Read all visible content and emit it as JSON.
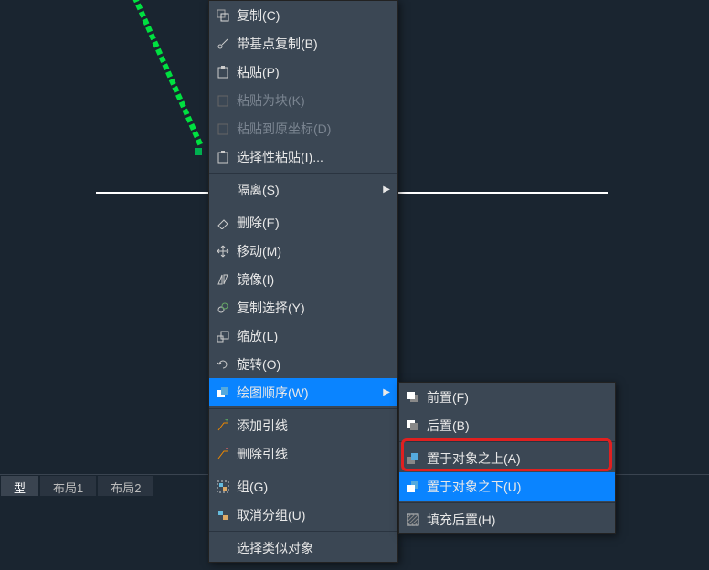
{
  "canvas": {
    "tabs": [
      "型",
      "布局1",
      "布局2"
    ]
  },
  "menu": {
    "items": [
      {
        "icon": "copy-icon",
        "label": "复制(C)"
      },
      {
        "icon": "basepoint-copy-icon",
        "label": "带基点复制(B)"
      },
      {
        "icon": "paste-icon",
        "label": "粘贴(P)"
      },
      {
        "icon": "paste-block-icon",
        "label": "粘贴为块(K)",
        "disabled": true
      },
      {
        "icon": "paste-orig-icon",
        "label": "粘贴到原坐标(D)",
        "disabled": true
      },
      {
        "icon": "paste-special-icon",
        "label": "选择性粘贴(I)..."
      },
      {
        "separator": true
      },
      {
        "icon": "",
        "label": "隔离(S)",
        "submenu": true
      },
      {
        "separator": true
      },
      {
        "icon": "erase-icon",
        "label": "删除(E)"
      },
      {
        "icon": "move-icon",
        "label": "移动(M)"
      },
      {
        "icon": "mirror-icon",
        "label": "镜像(I)"
      },
      {
        "icon": "copysel-icon",
        "label": "复制选择(Y)"
      },
      {
        "icon": "scale-icon",
        "label": "缩放(L)"
      },
      {
        "icon": "rotate-icon",
        "label": "旋转(O)"
      },
      {
        "icon": "draworder-icon",
        "label": "绘图顺序(W)",
        "submenu": true,
        "highlighted": true
      },
      {
        "separator": true
      },
      {
        "icon": "addleader-icon",
        "label": "添加引线"
      },
      {
        "icon": "removeleader-icon",
        "label": "删除引线"
      },
      {
        "separator": true
      },
      {
        "icon": "group-icon",
        "label": "组(G)"
      },
      {
        "icon": "ungroup-icon",
        "label": "取消分组(U)"
      },
      {
        "separator": true
      },
      {
        "icon": "",
        "label": "选择类似对象"
      }
    ]
  },
  "submenu": {
    "items": [
      {
        "icon": "front-icon",
        "label": "前置(F)"
      },
      {
        "icon": "back-icon",
        "label": "后置(B)"
      },
      {
        "separator": true
      },
      {
        "icon": "above-icon",
        "label": "置于对象之上(A)"
      },
      {
        "icon": "below-icon",
        "label": "置于对象之下(U)",
        "highlighted": true
      },
      {
        "separator": true
      },
      {
        "icon": "hatch-back-icon",
        "label": "填充后置(H)"
      }
    ]
  }
}
